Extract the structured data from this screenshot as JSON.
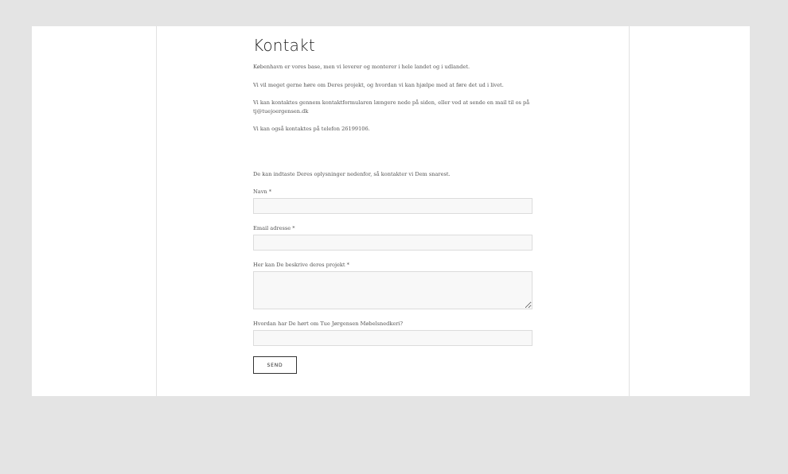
{
  "contact": {
    "title": "Kontakt",
    "paragraphs": [
      "København er vores base, men vi leverer og monterer i hele landet og i udlandet.",
      "Vi vil meget gerne høre om Deres projekt, og hvordan vi kan hjælpe med at føre det ud i livet.",
      "Vi kan kontaktes gennem kontaktformularen længere nede på siden, eller ved at sende en mail til os på tj@tuejoergensen.dk",
      "Vi kan også kontaktes på telefon 26199106."
    ]
  },
  "form": {
    "intro": "De kan indtaste Deres oplysninger nedenfor, så kontakter vi Dem snarest.",
    "name_label": "Navn *",
    "name_value": "",
    "email_label": "Email adresse *",
    "email_value": "",
    "project_label": "Her kan De beskrive deres projekt *",
    "project_value": "",
    "source_label": "Hvordan har De hørt om Tue Jørgensen Møbelsnedkeri?",
    "source_value": "",
    "send_label": "SEND"
  }
}
